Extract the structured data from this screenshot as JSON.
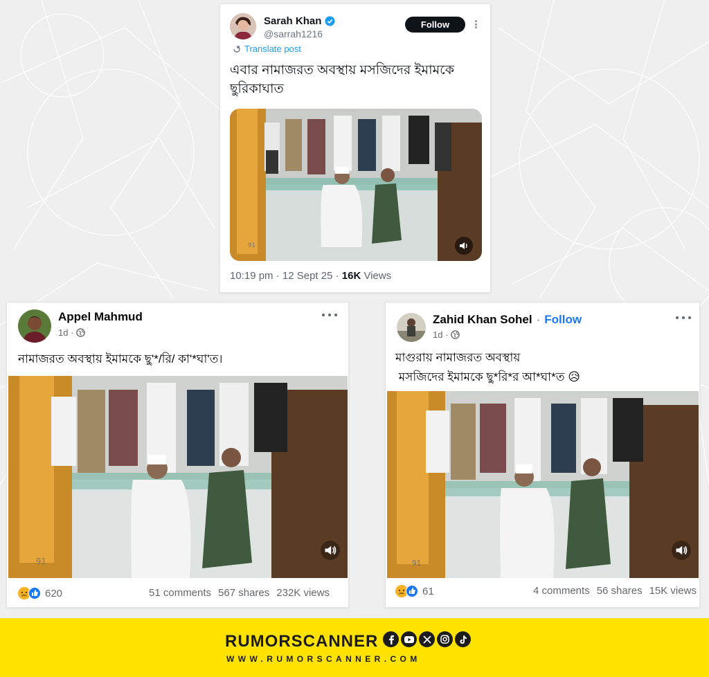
{
  "tweet": {
    "author_name": "Sarah Khan",
    "handle": "@sarrah1216",
    "follow_label": "Follow",
    "translate_label": "Translate post",
    "text": "এবার নামাজরত অবস্থায় মসজিদের ইমামকে ছুরিকাঘাত",
    "time": "10:19 pm · 12 Sept 25 · ",
    "views_count": "16K",
    "views_label": " Views"
  },
  "post1": {
    "author_name": "Appel Mahmud",
    "time": "1d ·",
    "text": "নামাজরত অবস্থায় ইমামকে  ছু'*/রি/ কা'*ঘা'ত।",
    "reaction_count": "620",
    "comments": "51 comments",
    "shares": "567 shares",
    "views": "232K views"
  },
  "post2": {
    "author_name": "Zahid Khan Sohel",
    "separator": "·",
    "follow_label": "Follow",
    "time": "1d ·",
    "text_line1": "মাগুরায় নামাজরত অবস্থায়",
    "text_line2": " মসজিদের ইমামকে ছু*রি*র আ*ঘা*ত 😥",
    "reaction_count": "61",
    "comments": "4 comments",
    "shares": "56 shares",
    "views": "15K views"
  },
  "footer": {
    "brand": "RUMORSCANNER",
    "website": "WWW.RUMORSCANNER.COM",
    "socials": [
      "facebook-icon",
      "youtube-icon",
      "x-icon",
      "instagram-icon",
      "tiktok-icon"
    ]
  },
  "colors": {
    "footer_bg": "#ffe200",
    "fb_blue": "#1877f2",
    "x_blue": "#1d9bf0"
  }
}
